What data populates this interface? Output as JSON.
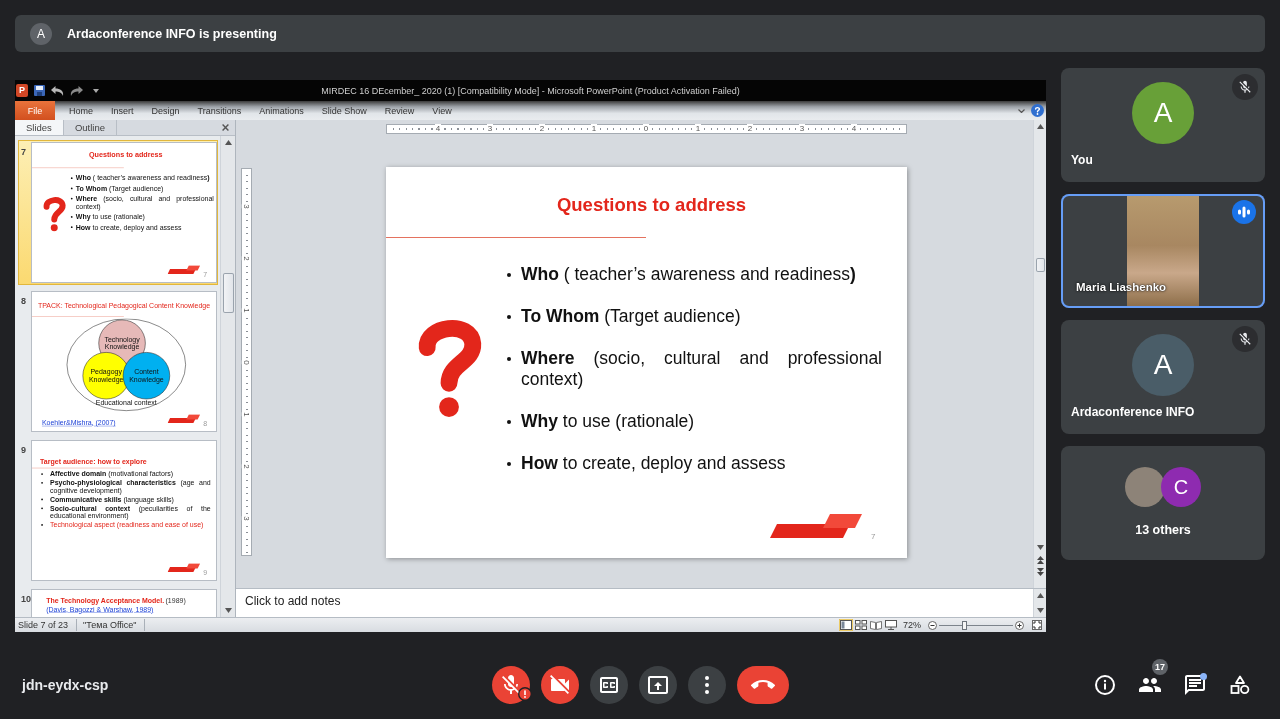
{
  "banner": {
    "avatar_letter": "A",
    "text": "Ardaconference INFO is presenting"
  },
  "presentation": {
    "app_icon_letter": "P",
    "window_title": "MIRDEC 16 DEcember_ 2020 (1) [Compatibility Mode] - Microsoft PowerPoint (Product Activation Failed)",
    "ribbon_tabs": [
      {
        "label": "File",
        "kind": "file",
        "selected": false
      },
      {
        "label": "Home",
        "kind": "tab",
        "selected": false
      },
      {
        "label": "Insert",
        "kind": "tab",
        "selected": false
      },
      {
        "label": "Design",
        "kind": "tab",
        "selected": false
      },
      {
        "label": "Transitions",
        "kind": "tab",
        "selected": false
      },
      {
        "label": "Animations",
        "kind": "tab",
        "selected": false
      },
      {
        "label": "Slide Show",
        "kind": "tab",
        "selected": false
      },
      {
        "label": "Review",
        "kind": "tab",
        "selected": false
      },
      {
        "label": "View",
        "kind": "tab",
        "selected": false
      }
    ],
    "panel_tabs": [
      {
        "label": "Slides",
        "selected": true
      },
      {
        "label": "Outline",
        "selected": false
      }
    ],
    "thumbnails": [
      {
        "number": "7",
        "selected": true,
        "slide": {
          "kind": "question_list",
          "title": "Questions to address",
          "bullets": [
            "**Who** ( teacher’s awareness and readiness**)**",
            "**To Whom** (Target audience)",
            "**Where** (socio, cultural and professional context)",
            "**Why** to use (rationale)",
            "**How** to create, deploy and assess"
          ],
          "logo": true,
          "page_number": "7"
        }
      },
      {
        "number": "8",
        "selected": false,
        "slide": {
          "kind": "venn",
          "title": "TPACK: Technological Pedagogical Content Knowledge",
          "circles": [
            {
              "label": "Technology Knowledge",
              "color": "#e6b9b8"
            },
            {
              "label": "Pedagogy Knowledge",
              "color": "#ffff00"
            },
            {
              "label": "Content Knowledge",
              "color": "#00b0f0"
            }
          ],
          "context": "Educational context",
          "citation": "Koehler&Mishra, (2007)",
          "logo": true,
          "page_number": "8"
        }
      },
      {
        "number": "9",
        "selected": false,
        "slide": {
          "kind": "bullet_list",
          "title": "Target audience: how to explore",
          "bullets": [
            {
              "text": "**Affective domain** (motivational factors)",
              "highlighted": false
            },
            {
              "text": "**Psycho-physiological characteristics** (age and cognitive development)",
              "highlighted": false
            },
            {
              "text": "**Communicative skills** (language skills)",
              "highlighted": false
            },
            {
              "text": "**Socio-cultural context** (peculiarities of the educational environment)",
              "highlighted": false
            },
            {
              "text": "Technological aspect (readiness and ease of use)",
              "highlighted": true
            }
          ],
          "logo": true,
          "page_number": "9"
        }
      },
      {
        "number": "10",
        "selected": false,
        "slide": {
          "kind": "title_citation",
          "title": "The Technology Acceptance Model.",
          "title_note": "(1989)",
          "citation": "(Davis, Bagozzi & Warshaw, 1989)"
        }
      }
    ],
    "ruler": {
      "horizontal": [
        "4",
        "3",
        "2",
        "1",
        "0",
        "1",
        "2",
        "3",
        "4"
      ],
      "vertical": [
        "3",
        "2",
        "1",
        "0",
        "1",
        "2",
        "3"
      ]
    },
    "slide": {
      "kind": "question_list",
      "title": "Questions to address",
      "bullets": [
        "**Who** ( teacher’s awareness and readiness**)**",
        "**To Whom** (Target audience)",
        "**Where** (socio, cultural and professional context)",
        "**Why** to use (rationale)",
        "**How** to create, deploy and assess"
      ],
      "logo": true,
      "page_number": "7"
    },
    "notes": {
      "placeholder": "Click to add notes"
    },
    "status_bar": {
      "slide_position": "Slide 7 of 23",
      "theme": "\"Тема Office\"",
      "views": [
        {
          "kind": "normal",
          "selected": true
        },
        {
          "kind": "sorter",
          "selected": false
        },
        {
          "kind": "reading",
          "selected": false
        },
        {
          "kind": "slideshow",
          "selected": false
        }
      ],
      "zoom": "72%",
      "zoom_slider": {
        "level": 0.35
      }
    }
  },
  "participants": [
    {
      "kind": "avatar",
      "name": "You",
      "avatar_letter": "A",
      "color": "#68a038",
      "muted": true,
      "speaking": false
    },
    {
      "kind": "video",
      "name": "Maria Liashenko",
      "muted": false,
      "speaking": true
    },
    {
      "kind": "avatar",
      "name": "Ardaconference INFO",
      "avatar_letter": "A",
      "color": "#4a5d68",
      "muted": true,
      "speaking": false
    },
    {
      "kind": "others",
      "label": "13 others",
      "avatars": [
        {
          "kind": "photo"
        },
        {
          "kind": "letter",
          "letter": "C",
          "color": "#8e2bb0"
        }
      ]
    }
  ],
  "call_controls": {
    "meeting_code": "jdn-eydx-csp",
    "buttons": [
      {
        "kind": "mic",
        "on": false,
        "alert": true
      },
      {
        "kind": "camera",
        "on": false
      },
      {
        "kind": "captions",
        "on": false
      },
      {
        "kind": "present"
      },
      {
        "kind": "more"
      },
      {
        "kind": "end_call"
      }
    ],
    "side_buttons": [
      {
        "kind": "info"
      },
      {
        "kind": "people",
        "badge": "17"
      },
      {
        "kind": "chat",
        "unread": true
      },
      {
        "kind": "activities"
      }
    ]
  }
}
